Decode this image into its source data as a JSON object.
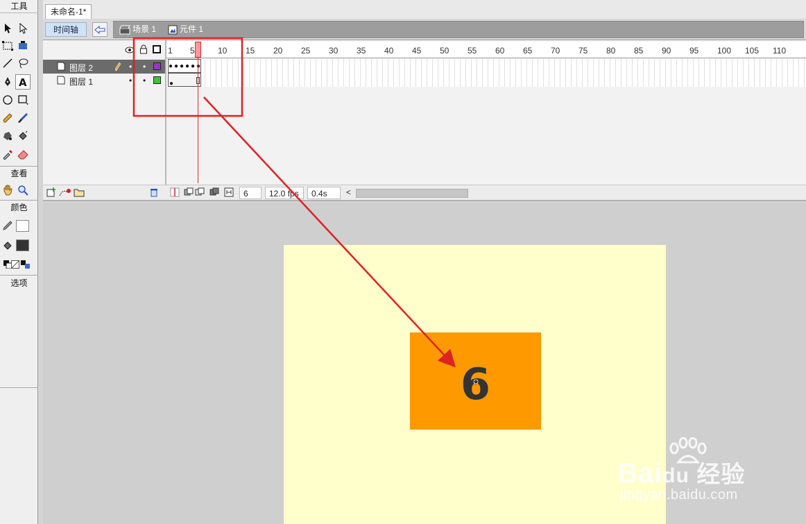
{
  "toolbar": {
    "tools_label": "工具",
    "view_label": "查看",
    "colors_label": "颜色",
    "options_label": "选项"
  },
  "document": {
    "tab_title": "未命名-1*"
  },
  "edit_bar": {
    "timeline_button": "时间轴",
    "breadcrumb_scene": "场景 1",
    "breadcrumb_symbol": "元件 1"
  },
  "timeline": {
    "ruler_labels": [
      "1",
      "5",
      "10",
      "15",
      "20",
      "25",
      "30",
      "35",
      "40",
      "45",
      "50",
      "55",
      "60",
      "65",
      "70",
      "75",
      "80",
      "85",
      "90",
      "95",
      "100",
      "105",
      "110"
    ],
    "layers": [
      {
        "name": "图层 2",
        "color": "#9933cc",
        "selected": true
      },
      {
        "name": "图层 1",
        "color": "#33cc33",
        "selected": false
      }
    ],
    "current_frame": "6",
    "frame_rate": "12.0 fps",
    "elapsed_time": "0.4s"
  },
  "stage": {
    "background_color": "#ffffcc",
    "symbol_color": "#ff9900",
    "symbol_text": "6"
  },
  "watermark": {
    "brand": "Bai  经验",
    "brand_du": "du",
    "url": "jingyan.baidu.com"
  },
  "annotation_color": "#dd2222"
}
